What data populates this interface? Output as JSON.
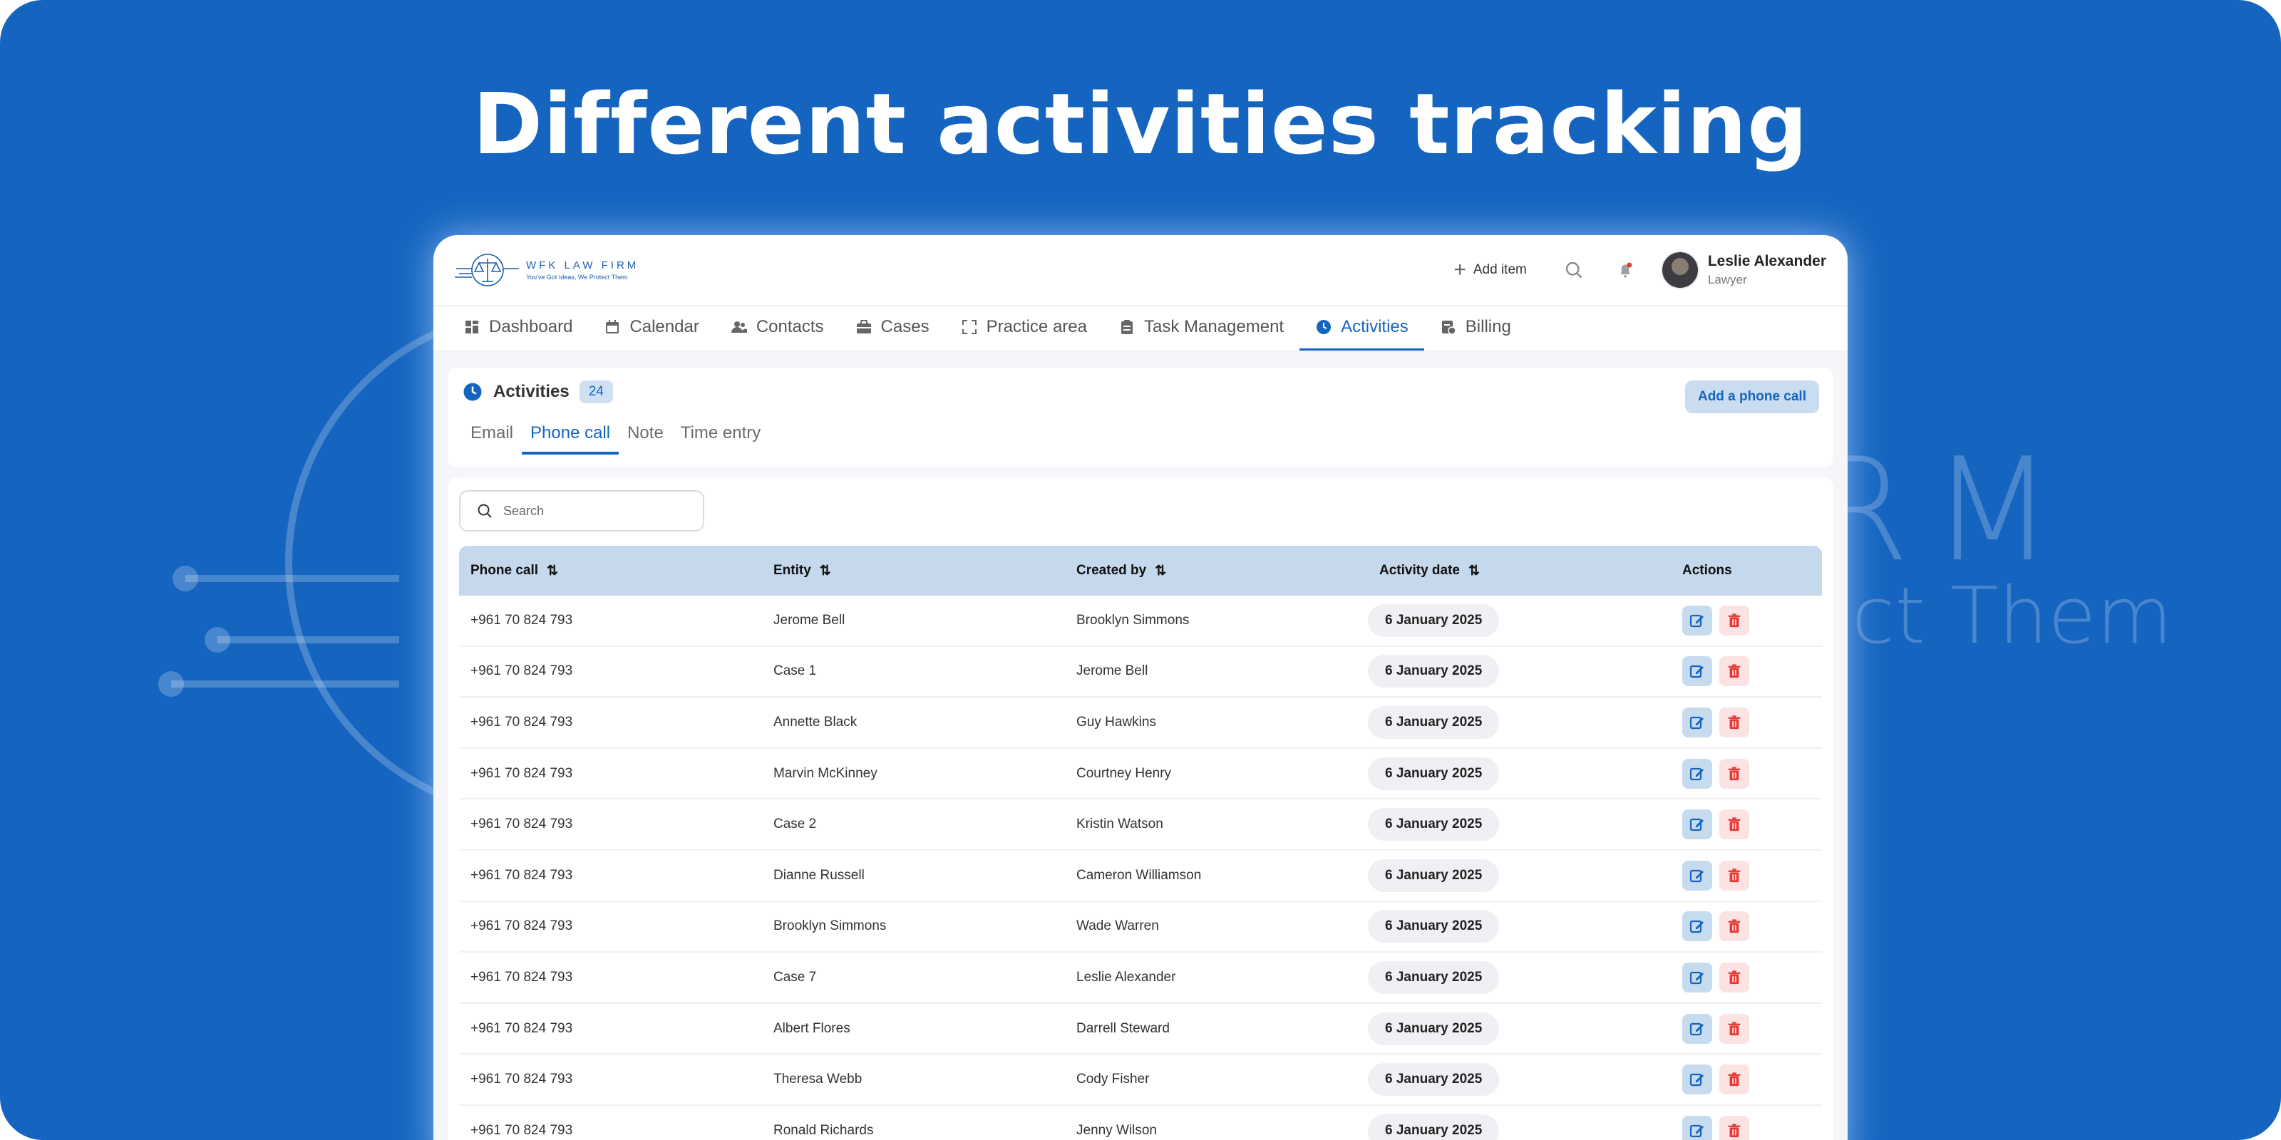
{
  "headline": "Different activities tracking",
  "watermark": {
    "line1": "RM",
    "line2": "ect Them"
  },
  "colors": {
    "background": "#1565c0",
    "accent": "#1565c0",
    "delete": "#e53935",
    "header_row": "#c5d8ec"
  },
  "logo": {
    "name": "WFK LAW FIRM",
    "tagline": "You've Got Ideas, We Protect Them"
  },
  "header": {
    "add_item": "Add item",
    "user": {
      "name": "Leslie Alexander",
      "role": "Lawyer"
    }
  },
  "nav": [
    {
      "label": "Dashboard",
      "icon": "dashboard-icon"
    },
    {
      "label": "Calendar",
      "icon": "calendar-icon"
    },
    {
      "label": "Contacts",
      "icon": "contacts-icon"
    },
    {
      "label": "Cases",
      "icon": "briefcase-icon"
    },
    {
      "label": "Practice area",
      "icon": "expand-icon"
    },
    {
      "label": "Task Management",
      "icon": "clipboard-icon"
    },
    {
      "label": "Activities",
      "icon": "clock-icon",
      "active": true
    },
    {
      "label": "Billing",
      "icon": "billing-icon"
    }
  ],
  "activities": {
    "title": "Activities",
    "count": "24",
    "add_button": "Add a phone call",
    "subtabs": [
      "Email",
      "Phone call",
      "Note",
      "Time entry"
    ],
    "active_subtab": "Phone call"
  },
  "search": {
    "placeholder": "Search"
  },
  "table": {
    "columns": [
      "Phone call",
      "Entity",
      "Created by",
      "Activity date",
      "Actions"
    ],
    "rows": [
      {
        "phone": "+961 70 824 793",
        "entity": "Jerome Bell",
        "created_by": "Brooklyn Simmons",
        "date": "6 January 2025"
      },
      {
        "phone": "+961 70 824 793",
        "entity": "Case 1",
        "created_by": "Jerome Bell",
        "date": "6 January 2025"
      },
      {
        "phone": "+961 70 824 793",
        "entity": "Annette Black",
        "created_by": "Guy Hawkins",
        "date": "6 January 2025"
      },
      {
        "phone": "+961 70 824 793",
        "entity": "Marvin McKinney",
        "created_by": "Courtney Henry",
        "date": "6 January 2025"
      },
      {
        "phone": "+961 70 824 793",
        "entity": "Case 2",
        "created_by": "Kristin Watson",
        "date": "6 January 2025"
      },
      {
        "phone": "+961 70 824 793",
        "entity": "Dianne Russell",
        "created_by": "Cameron Williamson",
        "date": "6 January 2025"
      },
      {
        "phone": "+961 70 824 793",
        "entity": "Brooklyn Simmons",
        "created_by": "Wade Warren",
        "date": "6 January 2025"
      },
      {
        "phone": "+961 70 824 793",
        "entity": "Case 7",
        "created_by": "Leslie Alexander",
        "date": "6 January 2025"
      },
      {
        "phone": "+961 70 824 793",
        "entity": "Albert Flores",
        "created_by": "Darrell Steward",
        "date": "6 January 2025"
      },
      {
        "phone": "+961 70 824 793",
        "entity": "Theresa Webb",
        "created_by": "Cody Fisher",
        "date": "6 January 2025"
      },
      {
        "phone": "+961 70 824 793",
        "entity": "Ronald Richards",
        "created_by": "Jenny Wilson",
        "date": "6 January 2025"
      }
    ]
  }
}
